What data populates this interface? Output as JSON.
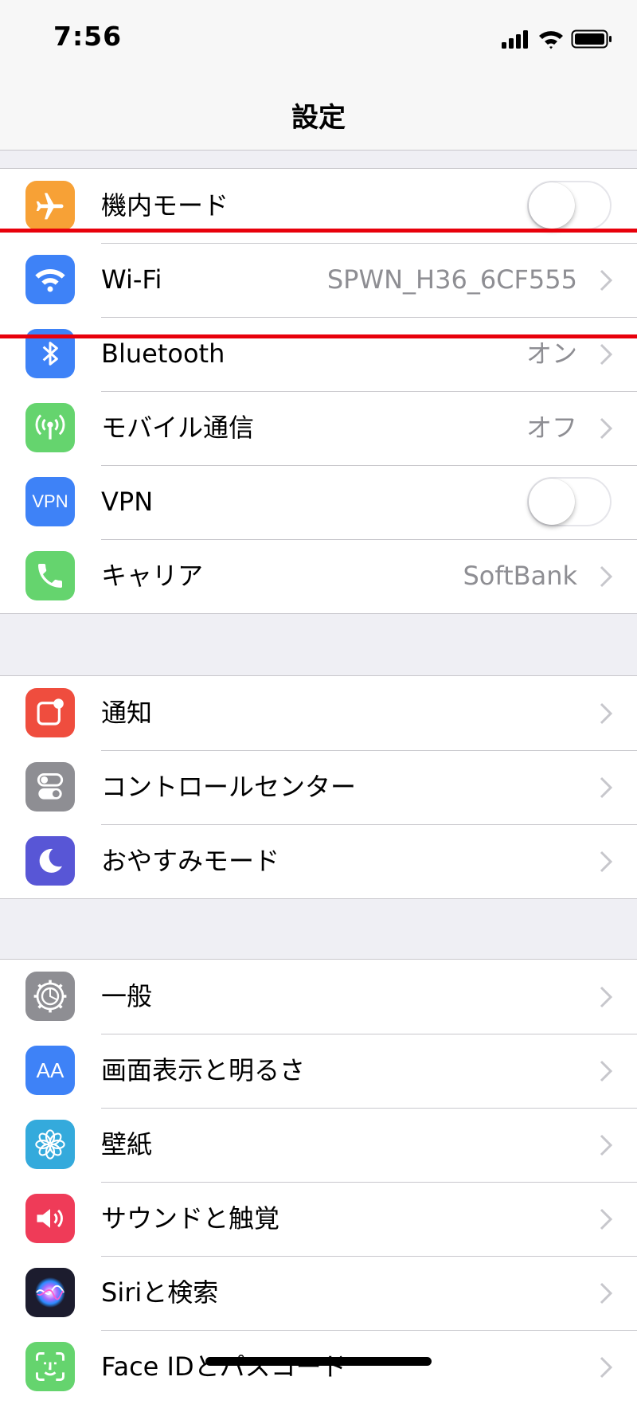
{
  "status_bar": {
    "time": "7:56"
  },
  "nav": {
    "title": "設定"
  },
  "group1": [
    {
      "label": "機内モード",
      "icon": "airplane-icon",
      "color": "#f7a136",
      "type": "toggle",
      "on": false
    },
    {
      "label": "Wi-Fi",
      "icon": "wifi-icon",
      "color": "#3e82f7",
      "type": "link",
      "detail": "SPWN_H36_6CF555"
    },
    {
      "label": "Bluetooth",
      "icon": "bluetooth-icon",
      "color": "#3e82f7",
      "type": "link",
      "detail": "オン"
    },
    {
      "label": "モバイル通信",
      "icon": "antenna-icon",
      "color": "#65d46e",
      "type": "link",
      "detail": "オフ"
    },
    {
      "label": "VPN",
      "icon": "vpn-icon",
      "icon_text": "VPN",
      "color": "#3e82f7",
      "type": "toggle",
      "on": false
    },
    {
      "label": "キャリア",
      "icon": "phone-icon",
      "color": "#65d46e",
      "type": "link",
      "detail": "SoftBank"
    }
  ],
  "group2": [
    {
      "label": "通知",
      "icon": "notifications-icon",
      "color": "#ef4d3e"
    },
    {
      "label": "コントロールセンター",
      "icon": "control-center-icon",
      "color": "#8e8e93"
    },
    {
      "label": "おやすみモード",
      "icon": "moon-icon",
      "color": "#5856d6"
    }
  ],
  "group3": [
    {
      "label": "一般",
      "icon": "gear-icon",
      "color": "#8e8e93"
    },
    {
      "label": "画面表示と明るさ",
      "icon": "text-size-icon",
      "icon_text": "AA",
      "color": "#3e82f7"
    },
    {
      "label": "壁紙",
      "icon": "wallpaper-flower-icon",
      "color": "#34aadc"
    },
    {
      "label": "サウンドと触覚",
      "icon": "speaker-icon",
      "color": "#ef3b58"
    },
    {
      "label": "Siriと検索",
      "icon": "siri-icon",
      "color": "#1c1c2e"
    },
    {
      "label": "Face IDとパスコード",
      "icon": "face-id-icon",
      "color": "#65d46e"
    }
  ],
  "annotation_color": "#e8000b"
}
